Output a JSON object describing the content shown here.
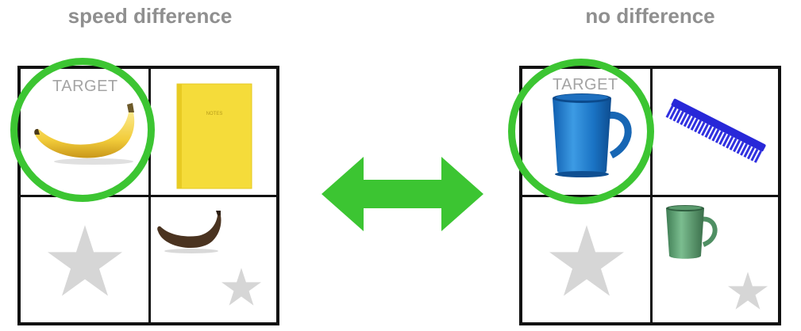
{
  "panels": [
    {
      "title": "speed difference",
      "target_label": "TARGET"
    },
    {
      "title": "no difference",
      "target_label": "TARGET"
    }
  ],
  "notebook_text": "NOTES",
  "colors": {
    "ring": "#3cc532",
    "arrow": "#3cc532",
    "title": "#8f8f8f",
    "star": "#d6d6d6",
    "grid_line": "#111111"
  },
  "icons": [
    "double-arrow-icon",
    "star-icon",
    "banana-icon",
    "notebook-icon",
    "mug-icon",
    "comb-icon"
  ]
}
